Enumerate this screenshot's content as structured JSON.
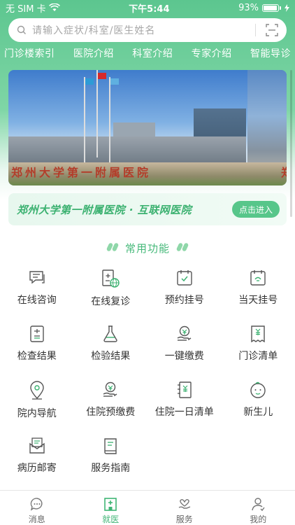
{
  "status": {
    "carrier": "无 SIM 卡",
    "time": "下午5:44",
    "battery": "93%"
  },
  "search": {
    "placeholder": "请输入症状/科室/医生姓名"
  },
  "nav": [
    "门诊楼索引",
    "医院介绍",
    "科室介绍",
    "专家介绍",
    "智能导诊"
  ],
  "banner": {
    "sign_text": "郑州大学第一附属医院",
    "sign_partial": "郑"
  },
  "promo": {
    "title": "郑州大学第一附属医院 · 互联网医院",
    "button": "点击进入"
  },
  "section": {
    "title": "常用功能"
  },
  "functions": [
    {
      "label": "在线咨询",
      "icon": "chat-icon"
    },
    {
      "label": "在线复诊",
      "icon": "online-revisit-icon"
    },
    {
      "label": "预约挂号",
      "icon": "calendar-check-icon"
    },
    {
      "label": "当天挂号",
      "icon": "calendar-today-icon"
    },
    {
      "label": "检查结果",
      "icon": "report-icon"
    },
    {
      "label": "检验结果",
      "icon": "flask-icon"
    },
    {
      "label": "一键缴费",
      "icon": "payment-hand-icon"
    },
    {
      "label": "门诊清单",
      "icon": "bill-icon"
    },
    {
      "label": "院内导航",
      "icon": "location-icon"
    },
    {
      "label": "住院预缴费",
      "icon": "prepay-icon"
    },
    {
      "label": "住院一日清单",
      "icon": "daily-list-icon"
    },
    {
      "label": "新生儿",
      "icon": "baby-icon"
    },
    {
      "label": "病历邮寄",
      "icon": "mail-icon"
    },
    {
      "label": "服务指南",
      "icon": "guide-book-icon"
    }
  ],
  "tabs": [
    {
      "label": "消息",
      "icon": "message-icon",
      "active": false
    },
    {
      "label": "就医",
      "icon": "hospital-icon",
      "active": true
    },
    {
      "label": "服务",
      "icon": "service-icon",
      "active": false
    },
    {
      "label": "我的",
      "icon": "profile-icon",
      "active": false
    }
  ],
  "colors": {
    "accent": "#57c68a",
    "accent_text": "#3bb170",
    "icon_stroke": "#555555"
  }
}
